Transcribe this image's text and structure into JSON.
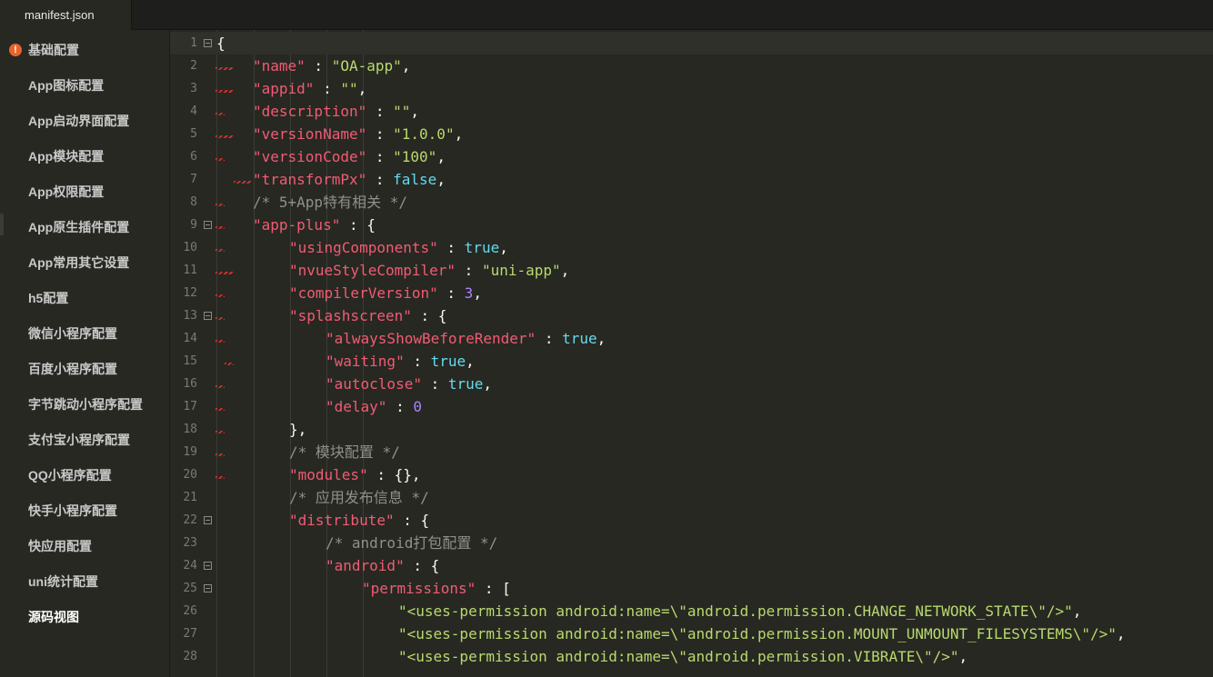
{
  "tab": {
    "title": "manifest.json"
  },
  "sidebar": {
    "items": [
      {
        "label": "基础配置",
        "warning": true
      },
      {
        "label": "App图标配置"
      },
      {
        "label": "App启动界面配置"
      },
      {
        "label": "App模块配置"
      },
      {
        "label": "App权限配置"
      },
      {
        "label": "App原生插件配置"
      },
      {
        "label": "App常用其它设置"
      },
      {
        "label": "h5配置"
      },
      {
        "label": "微信小程序配置"
      },
      {
        "label": "百度小程序配置"
      },
      {
        "label": "字节跳动小程序配置"
      },
      {
        "label": "支付宝小程序配置"
      },
      {
        "label": "QQ小程序配置"
      },
      {
        "label": "快手小程序配置"
      },
      {
        "label": "快应用配置"
      },
      {
        "label": "uni统计配置"
      },
      {
        "label": "源码视图",
        "active": true
      }
    ]
  },
  "editor": {
    "lines": [
      {
        "n": "1",
        "fold": true,
        "indent": 0,
        "tokens": [
          [
            "p",
            "{"
          ]
        ]
      },
      {
        "n": "2",
        "indent": 1,
        "tokens": [
          [
            "k",
            "\"name\""
          ],
          [
            "p",
            " : "
          ],
          [
            "s",
            "\"OA-app\""
          ],
          [
            "p",
            ","
          ]
        ]
      },
      {
        "n": "3",
        "indent": 1,
        "tokens": [
          [
            "k",
            "\"appid\""
          ],
          [
            "p",
            " : "
          ],
          [
            "s",
            "\"\""
          ],
          [
            "p",
            ","
          ]
        ]
      },
      {
        "n": "4",
        "indent": 1,
        "tokens": [
          [
            "k",
            "\"description\""
          ],
          [
            "p",
            " : "
          ],
          [
            "s",
            "\"\""
          ],
          [
            "p",
            ","
          ]
        ]
      },
      {
        "n": "5",
        "indent": 1,
        "tokens": [
          [
            "k",
            "\"versionName\""
          ],
          [
            "p",
            " : "
          ],
          [
            "s",
            "\"1.0.0\""
          ],
          [
            "p",
            ","
          ]
        ]
      },
      {
        "n": "6",
        "indent": 1,
        "tokens": [
          [
            "k",
            "\"versionCode\""
          ],
          [
            "p",
            " : "
          ],
          [
            "s",
            "\"100\""
          ],
          [
            "p",
            ","
          ]
        ]
      },
      {
        "n": "7",
        "indent": 1,
        "tokens": [
          [
            "k",
            "\"transformPx\""
          ],
          [
            "p",
            " : "
          ],
          [
            "b",
            "false"
          ],
          [
            "p",
            ","
          ]
        ]
      },
      {
        "n": "8",
        "indent": 1,
        "tokens": [
          [
            "c",
            "/* 5+App特有相关 */"
          ]
        ]
      },
      {
        "n": "9",
        "fold": true,
        "indent": 1,
        "tokens": [
          [
            "k",
            "\"app-plus\""
          ],
          [
            "p",
            " : {"
          ]
        ]
      },
      {
        "n": "10",
        "indent": 2,
        "tokens": [
          [
            "k",
            "\"usingComponents\""
          ],
          [
            "p",
            " : "
          ],
          [
            "b",
            "true"
          ],
          [
            "p",
            ","
          ]
        ]
      },
      {
        "n": "11",
        "indent": 2,
        "tokens": [
          [
            "k",
            "\"nvueStyleCompiler\""
          ],
          [
            "p",
            " : "
          ],
          [
            "s",
            "\"uni-app\""
          ],
          [
            "p",
            ","
          ]
        ]
      },
      {
        "n": "12",
        "indent": 2,
        "tokens": [
          [
            "k",
            "\"compilerVersion\""
          ],
          [
            "p",
            " : "
          ],
          [
            "n",
            "3"
          ],
          [
            "p",
            ","
          ]
        ]
      },
      {
        "n": "13",
        "fold": true,
        "indent": 2,
        "tokens": [
          [
            "k",
            "\"splashscreen\""
          ],
          [
            "p",
            " : {"
          ]
        ]
      },
      {
        "n": "14",
        "indent": 3,
        "tokens": [
          [
            "k",
            "\"alwaysShowBeforeRender\""
          ],
          [
            "p",
            " : "
          ],
          [
            "b",
            "true"
          ],
          [
            "p",
            ","
          ]
        ]
      },
      {
        "n": "15",
        "indent": 3,
        "tokens": [
          [
            "k",
            "\"waiting\""
          ],
          [
            "p",
            " : "
          ],
          [
            "b",
            "true"
          ],
          [
            "p",
            ","
          ]
        ]
      },
      {
        "n": "16",
        "indent": 3,
        "tokens": [
          [
            "k",
            "\"autoclose\""
          ],
          [
            "p",
            " : "
          ],
          [
            "b",
            "true"
          ],
          [
            "p",
            ","
          ]
        ]
      },
      {
        "n": "17",
        "indent": 3,
        "tokens": [
          [
            "k",
            "\"delay\""
          ],
          [
            "p",
            " : "
          ],
          [
            "n",
            "0"
          ]
        ]
      },
      {
        "n": "18",
        "indent": 2,
        "tokens": [
          [
            "p",
            "},"
          ]
        ]
      },
      {
        "n": "19",
        "indent": 2,
        "tokens": [
          [
            "c",
            "/* 模块配置 */"
          ]
        ]
      },
      {
        "n": "20",
        "indent": 2,
        "tokens": [
          [
            "k",
            "\"modules\""
          ],
          [
            "p",
            " : {},"
          ]
        ]
      },
      {
        "n": "21",
        "indent": 2,
        "tokens": [
          [
            "c",
            "/* 应用发布信息 */"
          ]
        ]
      },
      {
        "n": "22",
        "fold": true,
        "indent": 2,
        "tokens": [
          [
            "k",
            "\"distribute\""
          ],
          [
            "p",
            " : {"
          ]
        ]
      },
      {
        "n": "23",
        "indent": 3,
        "tokens": [
          [
            "c",
            "/* android打包配置 */"
          ]
        ]
      },
      {
        "n": "24",
        "fold": true,
        "indent": 3,
        "tokens": [
          [
            "k",
            "\"android\""
          ],
          [
            "p",
            " : {"
          ]
        ]
      },
      {
        "n": "25",
        "fold": true,
        "indent": 4,
        "tokens": [
          [
            "k",
            "\"permissions\""
          ],
          [
            "p",
            " : ["
          ]
        ]
      },
      {
        "n": "26",
        "indent": 5,
        "tokens": [
          [
            "s",
            "\"<uses-permission android:name=\\\"android.permission.CHANGE_NETWORK_STATE\\\"/>\""
          ],
          [
            "p",
            ","
          ]
        ]
      },
      {
        "n": "27",
        "indent": 5,
        "tokens": [
          [
            "s",
            "\"<uses-permission android:name=\\\"android.permission.MOUNT_UNMOUNT_FILESYSTEMS\\\"/>\""
          ],
          [
            "p",
            ","
          ]
        ]
      },
      {
        "n": "28",
        "indent": 5,
        "tokens": [
          [
            "s",
            "\"<uses-permission android:name=\\\"android.permission.VIBRATE\\\"/>\""
          ],
          [
            "p",
            ","
          ]
        ]
      }
    ]
  }
}
